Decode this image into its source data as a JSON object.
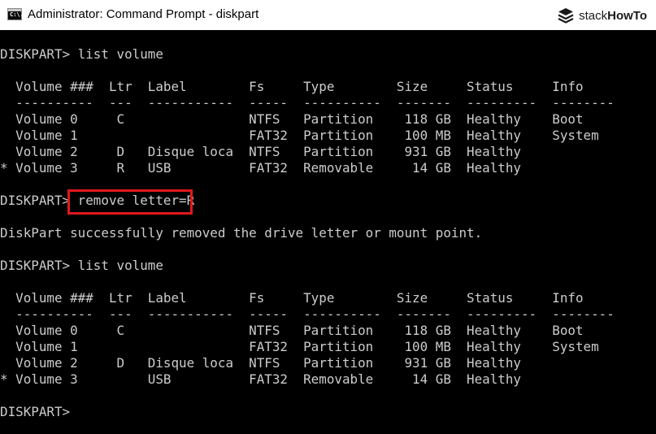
{
  "window": {
    "title": "Administrator: Command Prompt - diskpart",
    "app_icon_text": "C:\\.",
    "brand_stack": "stack",
    "brand_how": "HowTo"
  },
  "console": {
    "lines": [
      "DISKPART> list volume",
      "",
      "  Volume ###  Ltr  Label        Fs     Type        Size     Status     Info",
      "  ----------  ---  -----------  -----  ----------  -------  ---------  --------",
      "  Volume 0     C                NTFS   Partition    118 GB  Healthy    Boot",
      "  Volume 1                      FAT32  Partition    100 MB  Healthy    System",
      "  Volume 2     D   Disque loca  NTFS   Partition    931 GB  Healthy",
      "* Volume 3     R   USB          FAT32  Removable     14 GB  Healthy",
      "",
      "DISKPART> remove letter=R",
      "",
      "DiskPart successfully removed the drive letter or mount point.",
      "",
      "DISKPART> list volume",
      "",
      "  Volume ###  Ltr  Label        Fs     Type        Size     Status     Info",
      "  ----------  ---  -----------  -----  ----------  -------  ---------  --------",
      "  Volume 0     C                NTFS   Partition    118 GB  Healthy    Boot",
      "  Volume 1                      FAT32  Partition    100 MB  Healthy    System",
      "  Volume 2     D   Disque loca  NTFS   Partition    931 GB  Healthy",
      "* Volume 3         USB          FAT32  Removable     14 GB  Healthy",
      "",
      "DISKPART>"
    ]
  },
  "colors": {
    "console_background": "#000000",
    "console_text": "#cccccc",
    "highlight_border": "#e0191b",
    "titlebar_background": "#ffffff"
  }
}
